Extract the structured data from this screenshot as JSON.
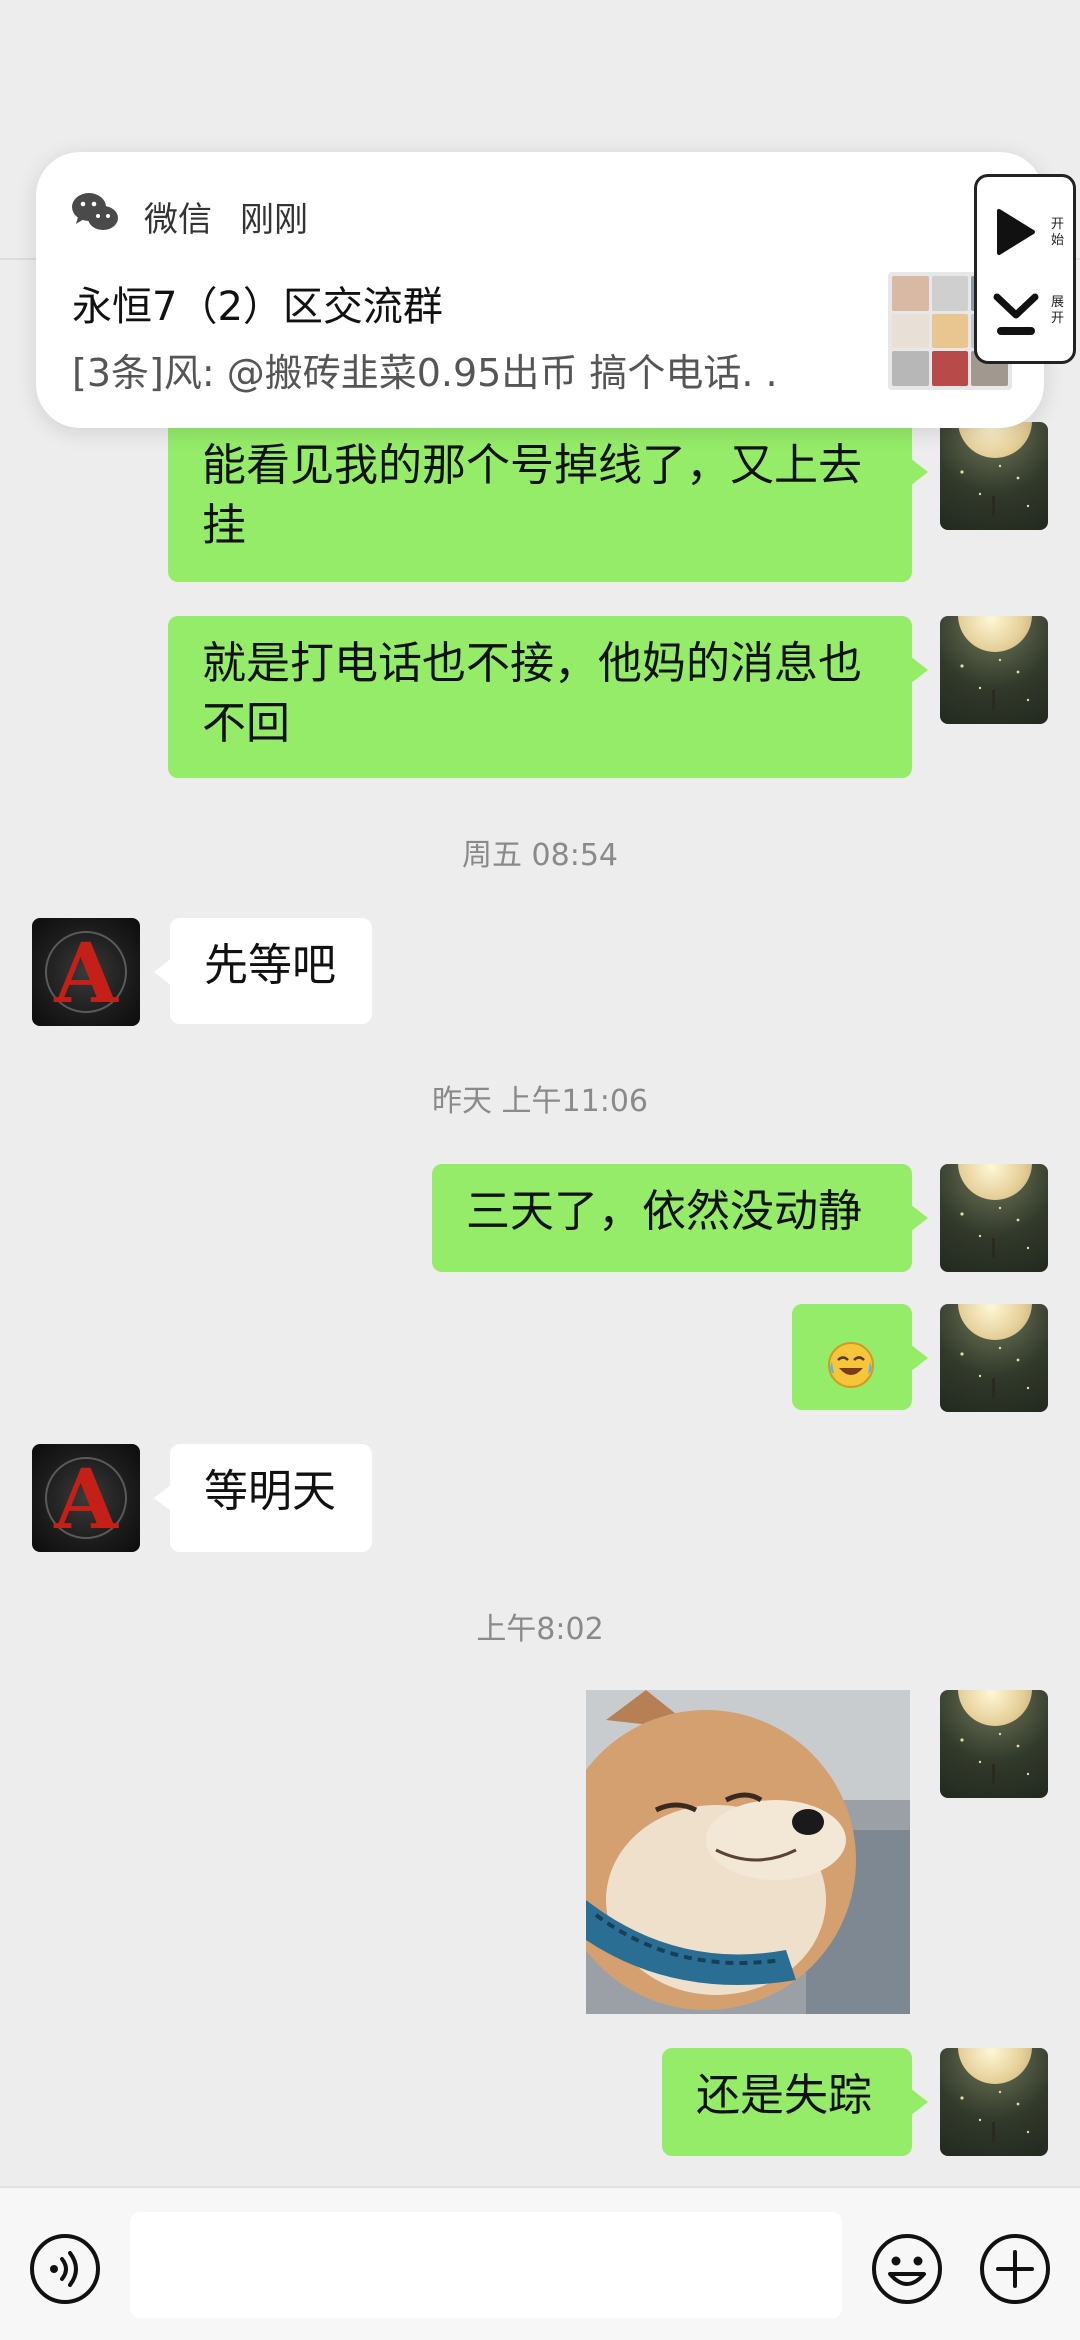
{
  "notification": {
    "app_name": "微信",
    "time": "刚刚",
    "title": "永恒7（2）区交流群",
    "body": "[3条]风: @搬砖韭菜0.95出币 搞个电话. .",
    "thumb_colors": [
      "#d9b9a3",
      "#cfcfcf",
      "#8b9aa9",
      "#e8e0d6",
      "#e9c58f",
      "#bfc7cf",
      "#b7b7b7",
      "#b84a4a",
      "#a1998f"
    ]
  },
  "float_widget": {
    "top_label": "开\n始",
    "bottom_label": "展\n开"
  },
  "messages": [
    {
      "text": "能看见我的那个号掉线了，又上去\n挂"
    },
    {
      "text": "就是打电话也不接，他妈的消息也\n不回"
    },
    {
      "timestamp": "周五 08:54"
    },
    {
      "text": "先等吧"
    },
    {
      "timestamp": "昨天 上午11:06"
    },
    {
      "text": "三天了，依然没动静"
    },
    {
      "emoji": "laughing-crying-emoji"
    },
    {
      "text": "等明天"
    },
    {
      "timestamp": "上午8:02"
    },
    {
      "image": "shiba-dog-sticker"
    },
    {
      "text": "还是失踪"
    }
  ],
  "colors": {
    "self_bubble": "#95ec69",
    "other_bubble": "#ffffff",
    "background": "#ededed"
  },
  "input_bar": {
    "placeholder": ""
  }
}
